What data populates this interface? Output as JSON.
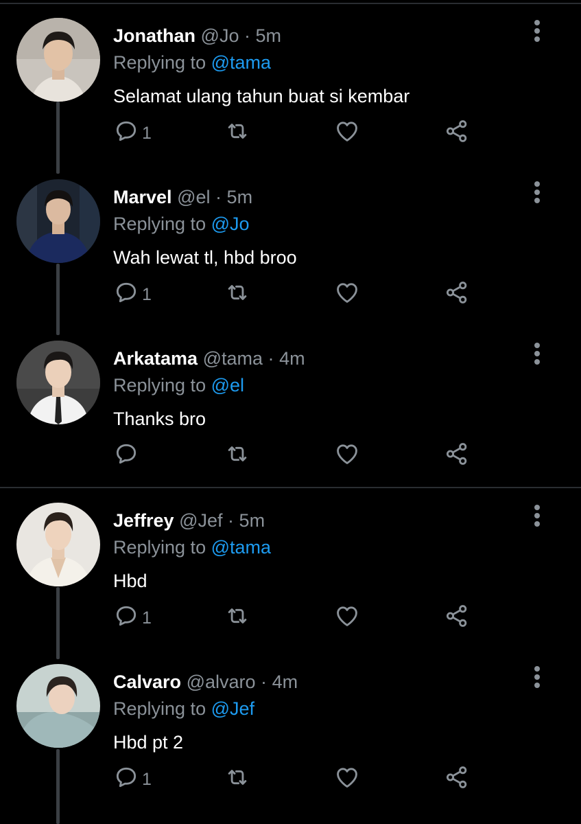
{
  "colors": {
    "background": "#000000",
    "accent": "#1d9bf0",
    "muted": "#8b9299",
    "thread_line": "#3b3f44"
  },
  "icons": {
    "reply": "reply-icon",
    "retweet": "retweet-icon",
    "like": "heart-icon",
    "share": "share-icon",
    "more": "more-vertical-icon"
  },
  "tweets": [
    {
      "name": "Jonathan",
      "handle": "@Jo",
      "sep": "·",
      "time": "5m",
      "replying_label": "Replying to",
      "replying_to": "@tama",
      "text": "Selamat ulang tahun buat si kembar",
      "reply_count": "1"
    },
    {
      "name": "Marvel",
      "handle": "@el",
      "sep": "·",
      "time": "5m",
      "replying_label": "Replying to",
      "replying_to": "@Jo",
      "text": "Wah lewat tl, hbd broo",
      "reply_count": "1"
    },
    {
      "name": "Arkatama",
      "handle": "@tama",
      "sep": "·",
      "time": "4m",
      "replying_label": "Replying to",
      "replying_to": "@el",
      "text": "Thanks bro",
      "reply_count": ""
    },
    {
      "name": "Jeffrey",
      "handle": "@Jef",
      "sep": "·",
      "time": "5m",
      "replying_label": "Replying to",
      "replying_to": "@tama",
      "text": "Hbd",
      "reply_count": "1"
    },
    {
      "name": "Calvaro",
      "handle": "@alvaro",
      "sep": "·",
      "time": "4m",
      "replying_label": "Replying to",
      "replying_to": "@Jef",
      "text": "Hbd pt 2",
      "reply_count": "1"
    }
  ]
}
